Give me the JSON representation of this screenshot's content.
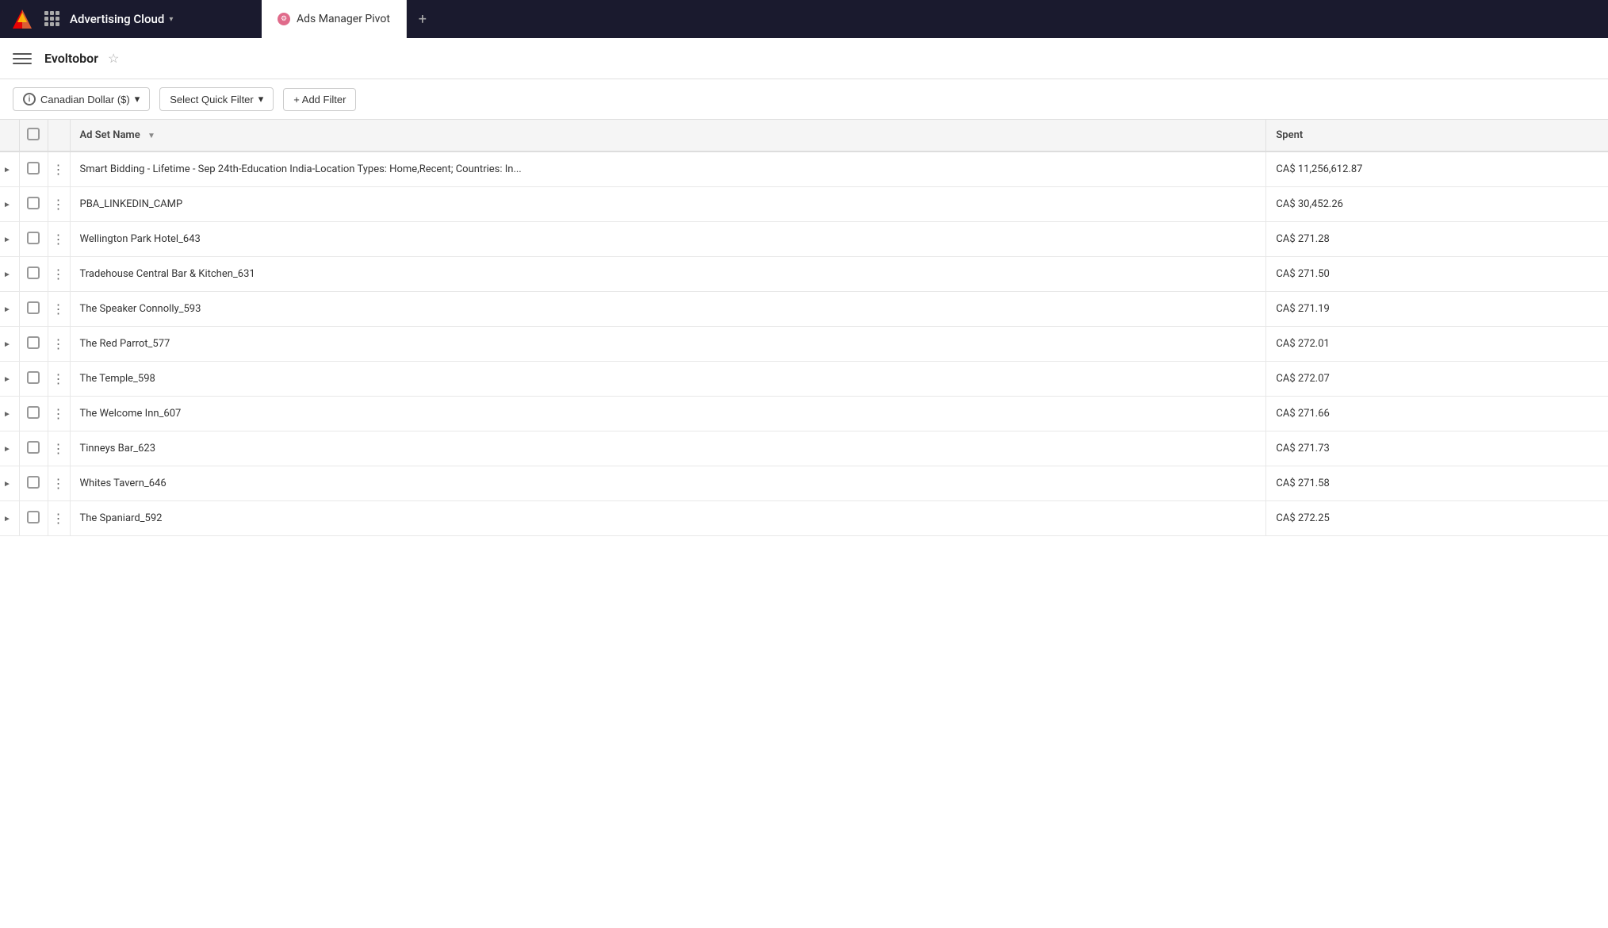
{
  "nav": {
    "logo_alt": "Adobe logo",
    "app_name": "Advertising Cloud",
    "app_chevron": "▾",
    "tab_label": "Ads Manager Pivot",
    "tab_icon": "⚙",
    "tab_add": "+"
  },
  "subheader": {
    "workspace": "Evoltobor",
    "star": "☆"
  },
  "toolbar": {
    "currency_label": "Canadian Dollar ($)",
    "currency_chevron": "▾",
    "filter_label": "Select Quick Filter",
    "filter_chevron": "▾",
    "add_filter_label": "+ Add Filter"
  },
  "table": {
    "columns": [
      {
        "key": "adset",
        "label": "Ad Set Name",
        "sortable": true
      },
      {
        "key": "spent",
        "label": "Spent",
        "sortable": false
      }
    ],
    "rows": [
      {
        "name": "Smart Bidding - Lifetime - Sep 24th-Education India-Location Types: Home,Recent; Countries: In...",
        "spent": "CA$ 11,256,612.87"
      },
      {
        "name": "PBA_LINKEDIN_CAMP",
        "spent": "CA$ 30,452.26"
      },
      {
        "name": "Wellington Park Hotel_643",
        "spent": "CA$ 271.28"
      },
      {
        "name": "Tradehouse Central Bar & Kitchen_631",
        "spent": "CA$ 271.50"
      },
      {
        "name": "The Speaker Connolly_593",
        "spent": "CA$ 271.19"
      },
      {
        "name": "The Red Parrot_577",
        "spent": "CA$ 272.01"
      },
      {
        "name": "The Temple_598",
        "spent": "CA$ 272.07"
      },
      {
        "name": "The Welcome Inn_607",
        "spent": "CA$ 271.66"
      },
      {
        "name": "Tinneys Bar_623",
        "spent": "CA$ 271.73"
      },
      {
        "name": "Whites Tavern_646",
        "spent": "CA$ 271.58"
      },
      {
        "name": "The Spaniard_592",
        "spent": "CA$ 272.25"
      }
    ]
  }
}
